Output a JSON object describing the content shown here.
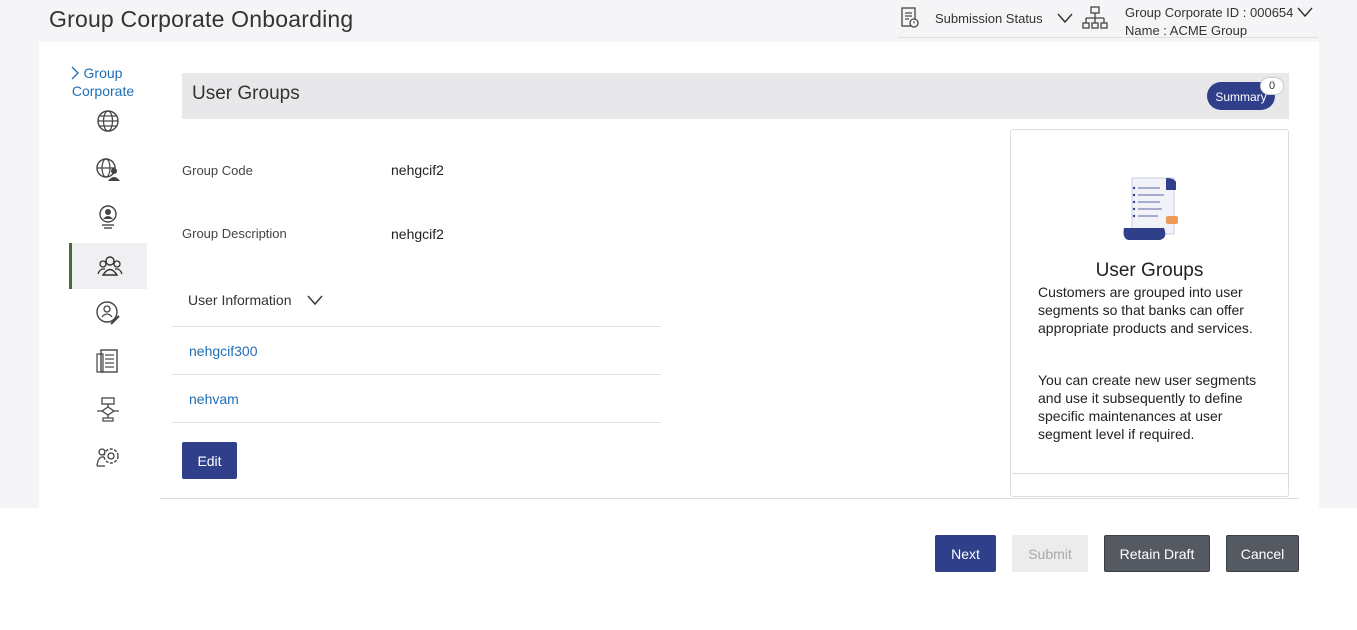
{
  "header": {
    "title": "Group Corporate Onboarding",
    "submission_status_label": "Submission Status",
    "group_corporate_id": "Group Corporate ID : 000654",
    "group_name": "Name : ACME Group"
  },
  "sidenav": {
    "link_label": "Group Corporate",
    "items": [
      {
        "icon": "globe-search-icon"
      },
      {
        "icon": "globe-user-icon"
      },
      {
        "icon": "user-badge-icon"
      },
      {
        "icon": "user-group-icon",
        "active": true
      },
      {
        "icon": "user-edit-icon"
      },
      {
        "icon": "document-list-icon"
      },
      {
        "icon": "workflow-icon"
      },
      {
        "icon": "user-settings-icon"
      }
    ]
  },
  "section": {
    "title": "User Groups",
    "summary_label": "Summary",
    "summary_count": "0"
  },
  "fields": {
    "group_code_label": "Group Code",
    "group_code_value": "nehgcif2",
    "group_desc_label": "Group Description",
    "group_desc_value": "nehgcif2"
  },
  "user_info": {
    "label": "User Information",
    "users": [
      "nehgcif300",
      "nehvam"
    ]
  },
  "edit_label": "Edit",
  "info_panel": {
    "icon": "document-checklist-icon",
    "title": "User Groups",
    "paragraph1": "Customers are grouped into user segments so that banks can offer appropriate products and services.",
    "paragraph2": "You can create new user segments and use it subsequently to define specific maintenances at user segment level if required."
  },
  "actions": {
    "next": "Next",
    "submit": "Submit",
    "retain_draft": "Retain Draft",
    "cancel": "Cancel"
  },
  "colors": {
    "primary": "#303f8a",
    "link": "#1e6db5",
    "secondary_button": "#555a62",
    "active_nav_border": "#4a6b3a"
  }
}
